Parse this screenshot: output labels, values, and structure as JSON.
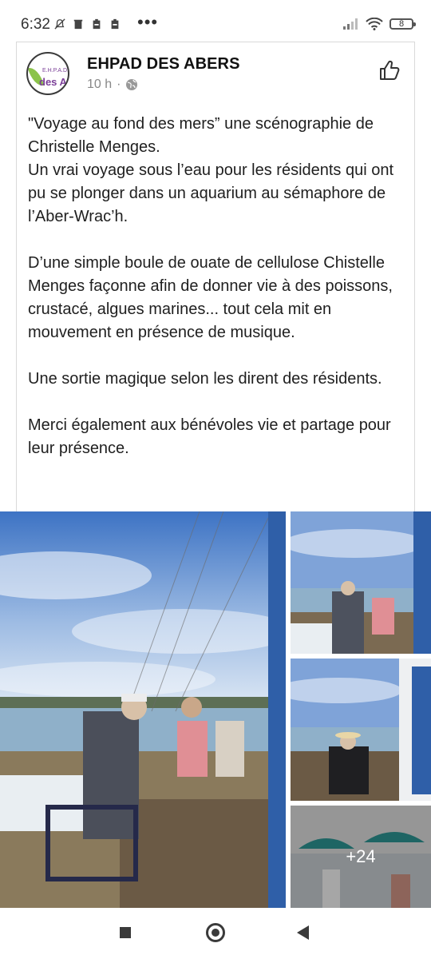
{
  "status_bar": {
    "time": "6:32",
    "dots": "•••",
    "battery": "8"
  },
  "post": {
    "page_name": "EHPAD DES ABERS",
    "time_ago": "10 h",
    "separator": "·",
    "avatar_small": "E.H.P.A.D.",
    "avatar_brand": "des AB",
    "text": "\"Voyage au fond des mers” une scénographie de Christelle Menges.\nUn vrai voyage sous l’eau pour les résidents qui ont pu se plonger dans un aquarium au sémaphore de l’Aber-Wrac’h.\n\nD’une simple boule de ouate de cellulose Chistelle Menges façonne afin de donner vie à des poissons, crustacé, algues marines... tout cela mit en mouvement en présence de musique.\n\nUne sortie magique selon les dirent des résidents.\n\nMerci également aux bénévoles vie et partage pour leur présence.",
    "more_photos": "+24"
  },
  "icons": {
    "like": "thumbs-up-icon",
    "audience": "globe-icon",
    "nav_recent": "square-icon",
    "nav_home": "circle-icon",
    "nav_back": "triangle-back-icon"
  },
  "colors": {
    "brand_purple": "#7b3f98",
    "brand_green": "#8bc34a",
    "sky": "#4a7fc8",
    "text": "#1f1f1f",
    "meta": "#888888"
  }
}
